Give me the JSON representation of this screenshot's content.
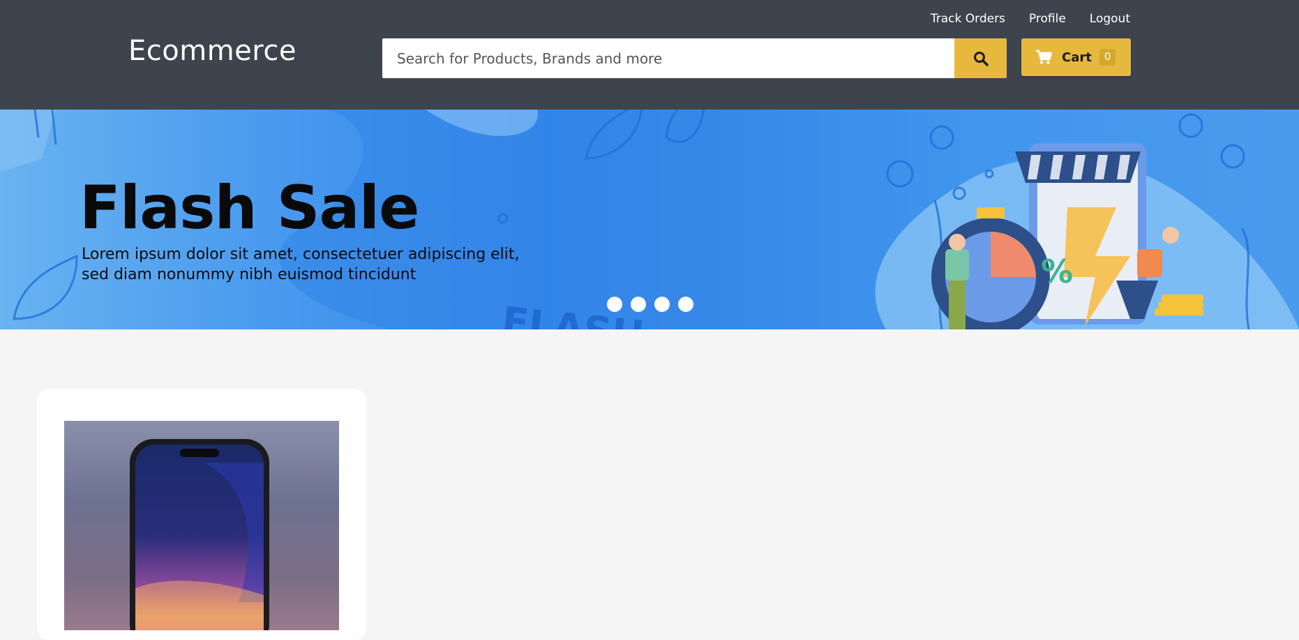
{
  "header": {
    "brand": "Ecommerce",
    "links": [
      "Track Orders",
      "Profile",
      "Logout"
    ],
    "search": {
      "placeholder": "Search for Products, Brands and more",
      "icon": "search-icon"
    },
    "cart": {
      "label": "Cart",
      "count": "0",
      "icon": "cart-icon"
    }
  },
  "banner": {
    "title": "Flash Sale",
    "text": "Lorem ipsum dolor sit amet, consectetuer adipiscing elit, sed diam nonummy nibh euismod tincidunt",
    "watermark": "FLASH",
    "slide_count": 4,
    "illustration_text": "%"
  },
  "products": [
    {
      "image": "smartphone-image"
    }
  ],
  "colors": {
    "header_bg": "#3e444d",
    "accent": "#e6b83e",
    "page_bg": "#f5f5f5"
  }
}
